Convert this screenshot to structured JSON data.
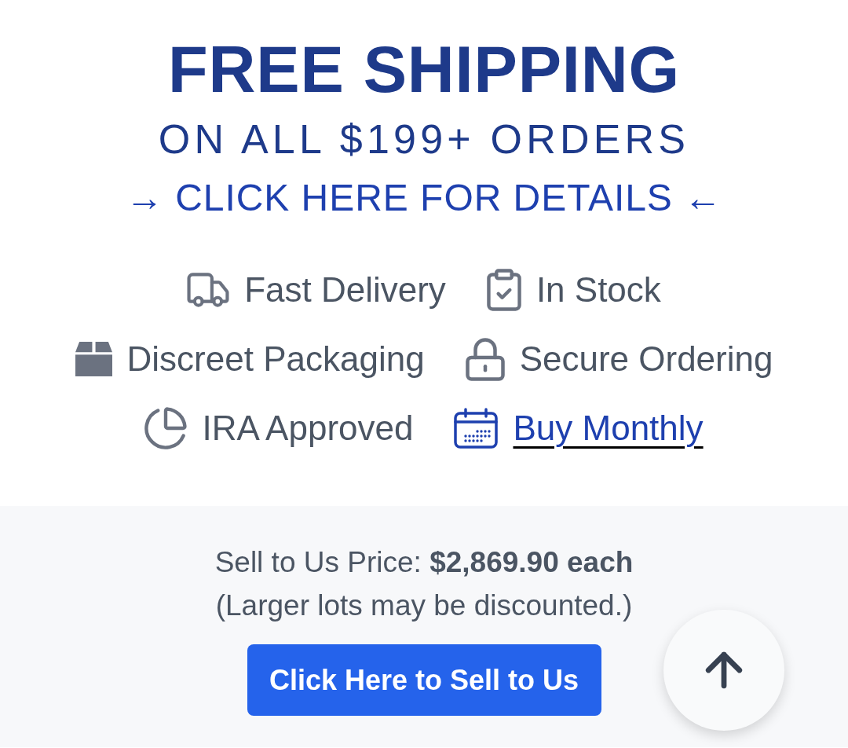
{
  "banner": {
    "title": "FREE SHIPPING",
    "subtitle": "ON ALL $199+ ORDERS",
    "details_link": "→ CLICK HERE FOR DETAILS ←"
  },
  "features": [
    {
      "label": "Fast Delivery",
      "kind": "text"
    },
    {
      "label": "In Stock",
      "kind": "text"
    },
    {
      "label": "Discreet Packaging",
      "kind": "text"
    },
    {
      "label": "Secure Ordering",
      "kind": "text"
    },
    {
      "label": "IRA Approved",
      "kind": "text"
    },
    {
      "label": "Buy Monthly",
      "kind": "link"
    }
  ],
  "sell_section": {
    "price_line": "Sell to Us Price: **$2,869.90 each**",
    "note": "(Larger lots may be discounted.)",
    "button": "Click Here to Sell to Us"
  }
}
